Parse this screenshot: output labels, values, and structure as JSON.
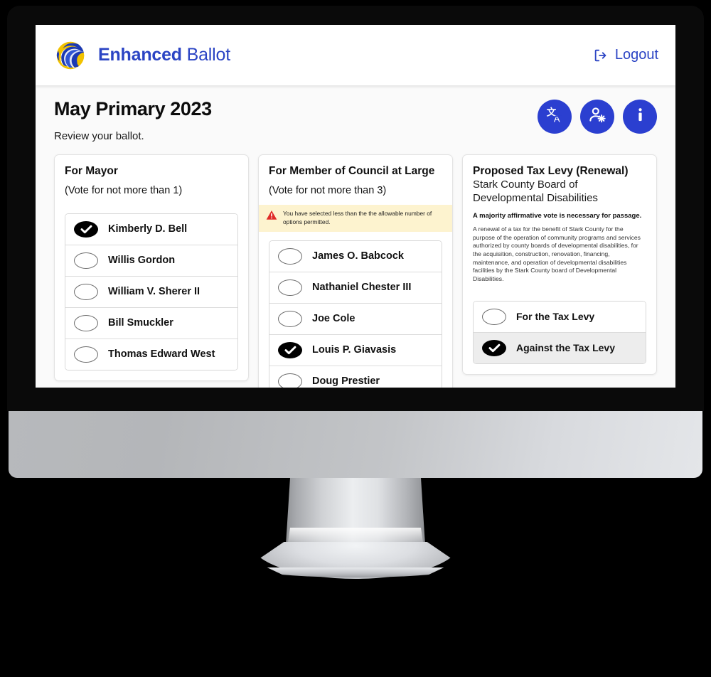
{
  "header": {
    "logo_icon": "enhanced-ballot-globe-logo",
    "brand_bold": "Enhanced",
    "brand_light": "Ballot",
    "logout_label": "Logout",
    "logout_icon": "logout-arrow-icon"
  },
  "page": {
    "title": "May Primary 2023",
    "subtitle": "Review your ballot."
  },
  "tools": [
    {
      "name": "translate-button",
      "icon": "translate-icon",
      "label": "Translate"
    },
    {
      "name": "accessibility-settings-button",
      "icon": "user-gear-icon",
      "label": "Accessibility settings"
    },
    {
      "name": "info-button",
      "icon": "info-icon",
      "label": "Information"
    }
  ],
  "colors": {
    "brand_blue": "#2b44c4",
    "button_blue": "#2b3fd0",
    "warning_bg": "#fdf3cf",
    "warning_icon": "#e02b27",
    "selected_fill": "#000000",
    "page_bg": "#fafafa"
  },
  "contests": [
    {
      "name": "contest-mayor",
      "title": "For Mayor",
      "instruction": "(Vote for not more than 1)",
      "warning": null,
      "options": [
        {
          "label": "Kimberly D. Bell",
          "selected": true
        },
        {
          "label": "Willis Gordon",
          "selected": false
        },
        {
          "label": "William V. Sherer II",
          "selected": false
        },
        {
          "label": "Bill Smuckler",
          "selected": false
        },
        {
          "label": "Thomas Edward West",
          "selected": false
        }
      ]
    },
    {
      "name": "contest-council-at-large",
      "title": "For Member of Council at Large",
      "instruction": "(Vote for not more than 3)",
      "warning": "You have selected less than the the allowable number of options permitted.",
      "options": [
        {
          "label": "James O. Babcock",
          "selected": false
        },
        {
          "label": "Nathaniel Chester III",
          "selected": false
        },
        {
          "label": "Joe Cole",
          "selected": false
        },
        {
          "label": "Louis P. Giavasis",
          "selected": true
        },
        {
          "label": "Doug Prestier",
          "selected": false
        }
      ]
    }
  ],
  "issue": {
    "name": "contest-tax-levy",
    "title": "Proposed Tax Levy (Renewal)",
    "subtitle": "Stark County Board of Developmental Disabilities",
    "majority_note": "A majority affirmative vote is necessary for passage.",
    "body": "A renewal of a tax for the benefit of Stark County for the purpose of the operation of community programs and services authorized by county boards of developmental disabilities, for the acquisition, construction, renovation, financing, maintenance, and operation of developmental disabilities facilities by the Stark County board of Developmental Disabilities.",
    "options": [
      {
        "label": "For the Tax Levy",
        "selected": false
      },
      {
        "label": "Against the Tax Levy",
        "selected": true
      }
    ]
  }
}
